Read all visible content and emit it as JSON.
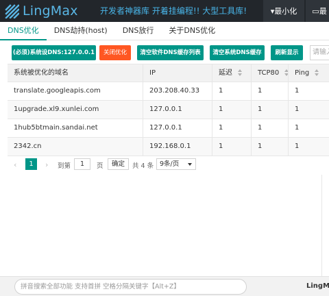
{
  "app": {
    "name": "LingMax",
    "slogan": "开发者神器库 开着挂编程!! 大型工具库!",
    "minimize_label": "▾最小化",
    "maximize_label": "▭最",
    "accent": "#009688",
    "brand_blue": "#49b5e8"
  },
  "tabs": [
    {
      "label": "DNS优化",
      "active": true
    },
    {
      "label": "DNS劫持(host)",
      "active": false
    },
    {
      "label": "DNS放行",
      "active": false
    },
    {
      "label": "关于DNS优化",
      "active": false
    }
  ],
  "toolbar": {
    "set_dns": "(必须)系统设DNS:127.0.0.1",
    "disable": "关闭优化",
    "clear_soft_cache": "清空软件DNS缓存列表",
    "clear_sys_cache": "清空系统DNS缓存",
    "refresh": "刷新显示",
    "search_placeholder": "请输入"
  },
  "table": {
    "headers": [
      "系统被优化的域名",
      "IP",
      "延迟",
      "TCP80",
      "Ping",
      ""
    ],
    "rows": [
      [
        "translate.googleapis.com",
        "203.208.40.33",
        "1",
        "1",
        "1",
        ""
      ],
      [
        "1upgrade.xl9.xunlei.com",
        "127.0.0.1",
        "1",
        "1",
        "1",
        ""
      ],
      [
        "1hub5btmain.sandai.net",
        "127.0.0.1",
        "1",
        "1",
        "1",
        ""
      ],
      [
        "2342.cn",
        "192.168.0.1",
        "1",
        "1",
        "1",
        ""
      ]
    ]
  },
  "pager": {
    "prev": "‹",
    "current": "1",
    "next": "›",
    "goto_label": "到第",
    "page_value": "1",
    "page_unit": "页",
    "confirm": "确定",
    "total": "共 4 条",
    "per_page": "9条/页"
  },
  "bottom": {
    "command_placeholder": "拼音搜索全部功能 支持首拼 空格分隔关键字【Alt+Z】",
    "brand": "LingMax"
  }
}
